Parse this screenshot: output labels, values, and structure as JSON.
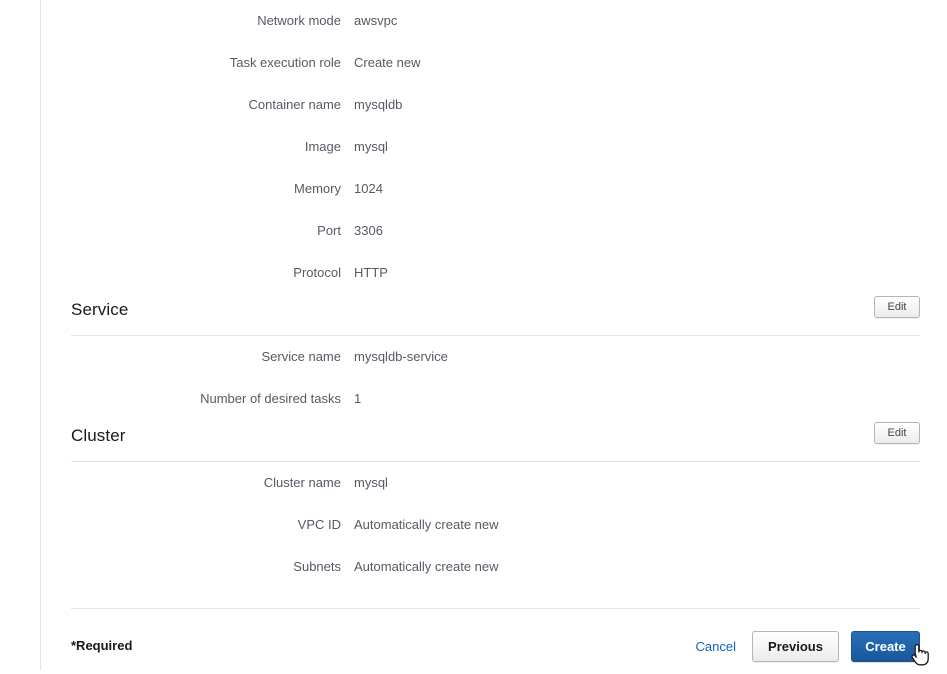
{
  "task_definition": {
    "rows": [
      {
        "label": "Network mode",
        "value": "awsvpc"
      },
      {
        "label": "Task execution role",
        "value": "Create new"
      },
      {
        "label": "Container name",
        "value": "mysqldb"
      },
      {
        "label": "Image",
        "value": "mysql"
      },
      {
        "label": "Memory",
        "value": "1024"
      },
      {
        "label": "Port",
        "value": "3306"
      },
      {
        "label": "Protocol",
        "value": "HTTP"
      }
    ]
  },
  "service": {
    "title": "Service",
    "edit_label": "Edit",
    "rows": [
      {
        "label": "Service name",
        "value": "mysqldb-service"
      },
      {
        "label": "Number of desired tasks",
        "value": "1"
      }
    ]
  },
  "cluster": {
    "title": "Cluster",
    "edit_label": "Edit",
    "rows": [
      {
        "label": "Cluster name",
        "value": "mysql"
      },
      {
        "label": "VPC ID",
        "value": "Automatically create new"
      },
      {
        "label": "Subnets",
        "value": "Automatically create new"
      }
    ]
  },
  "footer": {
    "required_note": "*Required",
    "cancel_label": "Cancel",
    "previous_label": "Previous",
    "create_label": "Create"
  },
  "colors": {
    "primary_button": "#2063ac",
    "link": "#0a65c4",
    "text": "#545b64",
    "heading": "#16191f",
    "rule": "#e4e4e4"
  }
}
